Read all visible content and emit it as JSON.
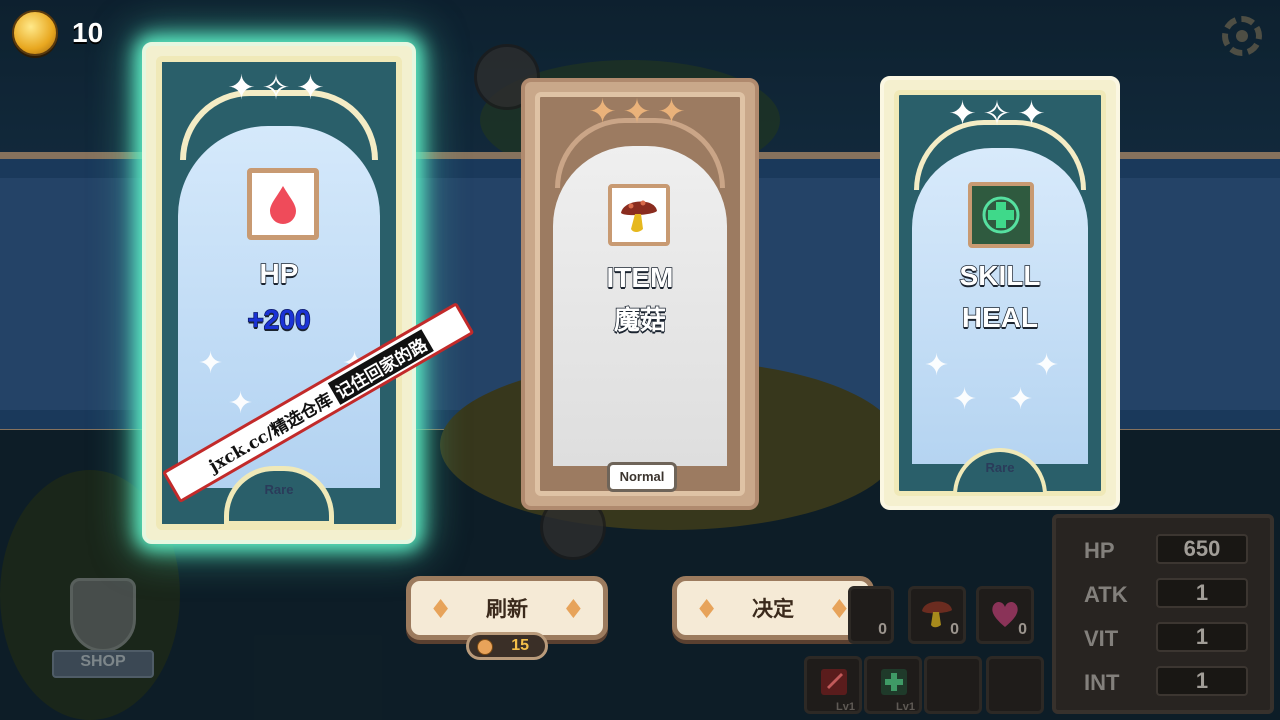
{
  "hud": {
    "coins": "10",
    "coin_icon": "gold-coin-icon",
    "settings_icon": "gear-icon"
  },
  "cards": [
    {
      "kind": "HP",
      "value": "+200",
      "rarity": "Rare",
      "icon": "blood-drop-icon",
      "selected": true
    },
    {
      "kind": "ITEM",
      "value": "魔菇",
      "rarity": "Normal",
      "icon": "mushroom-icon",
      "selected": false
    },
    {
      "kind": "SKILL",
      "value": "HEAL",
      "rarity": "Rare",
      "icon": "heal-cross-icon",
      "selected": false
    }
  ],
  "actions": {
    "refresh_label": "刷新",
    "refresh_cost": "15",
    "confirm_label": "决定"
  },
  "stats": [
    {
      "label": "HP",
      "value": "650"
    },
    {
      "label": "ATK",
      "value": "1"
    },
    {
      "label": "VIT",
      "value": "1"
    },
    {
      "label": "INT",
      "value": "1"
    }
  ],
  "inventory": [
    {
      "icon": "mushroom-icon",
      "qty": "0"
    },
    {
      "icon": "heart-potion-icon",
      "qty": "0"
    },
    {
      "icon": "sword-skill-icon",
      "level": "Lv1"
    },
    {
      "icon": "heal-skill-icon",
      "level": "Lv1"
    }
  ],
  "partial_counter": "0",
  "shop_label": "SHOP",
  "watermark": {
    "prefix": "jxck.cc/精选仓库",
    "highlight": "记住回家的路"
  },
  "colors": {
    "rare_glow": "#5df2c7",
    "hp_value": "#1b33d6",
    "accent_gold": "#f4c04a"
  }
}
